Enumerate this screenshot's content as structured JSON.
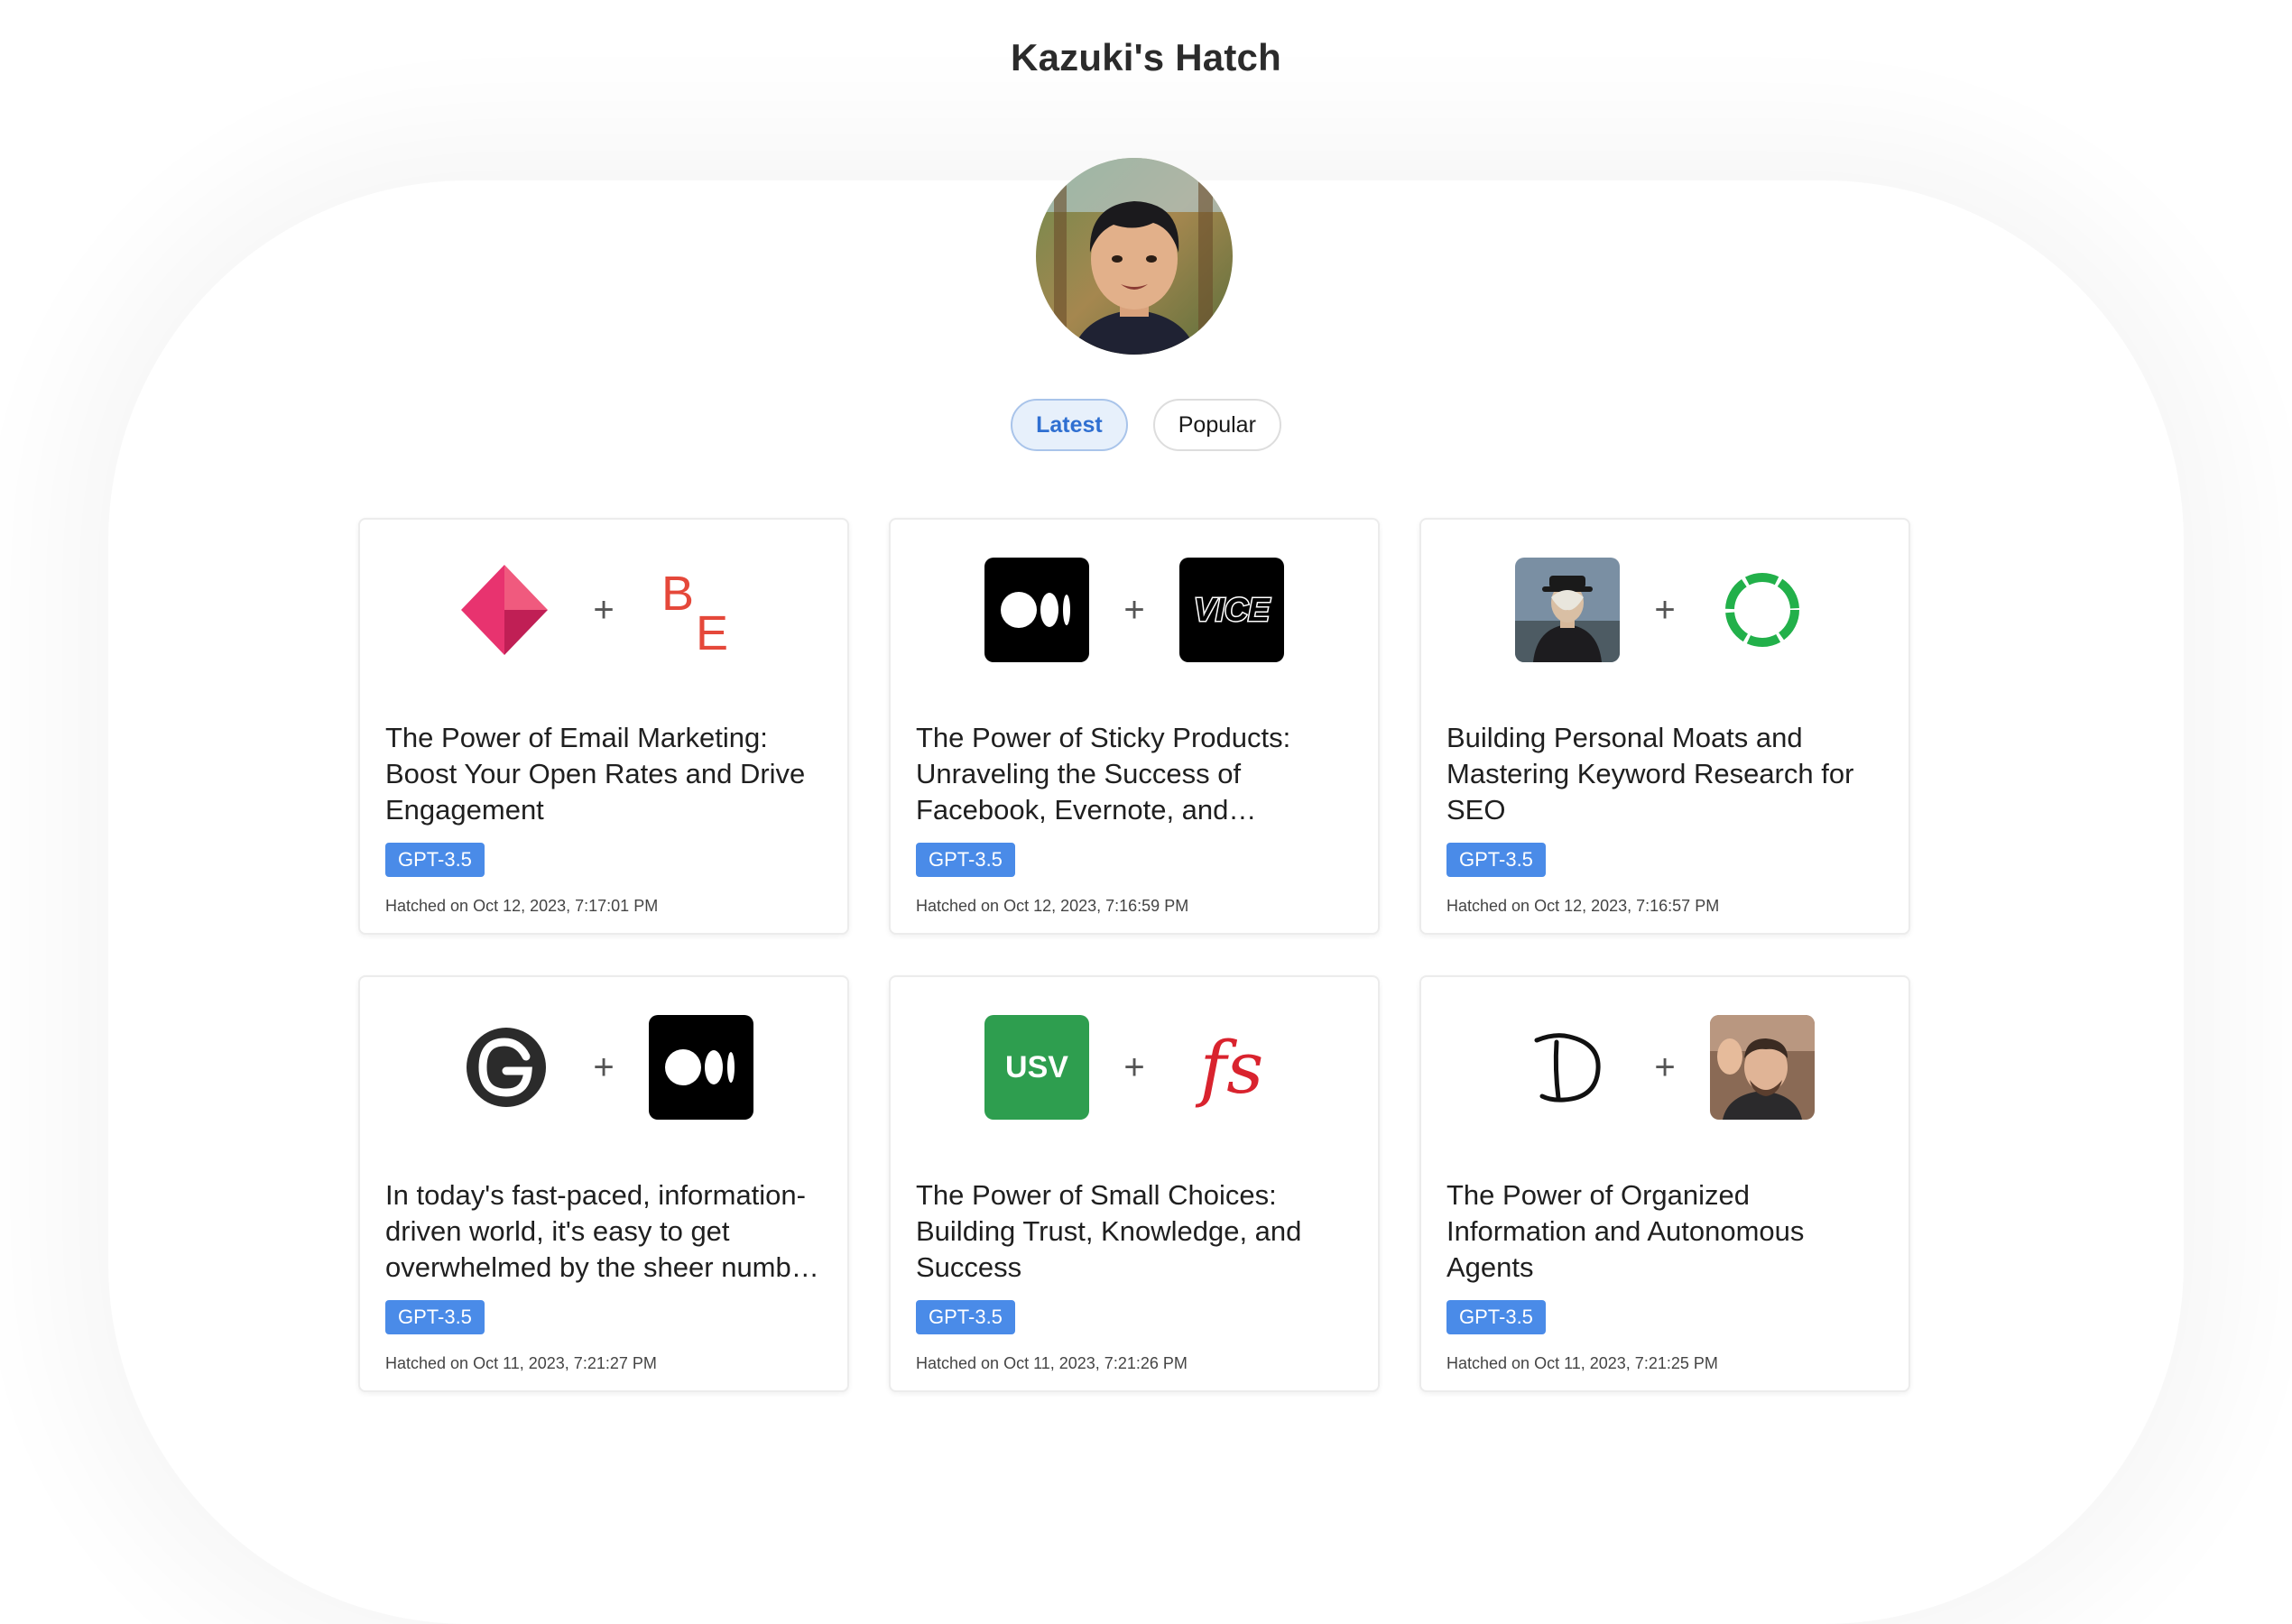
{
  "page": {
    "title": "Kazuki's Hatch"
  },
  "tabs": [
    {
      "label": "Latest",
      "active": true
    },
    {
      "label": "Popular",
      "active": false
    }
  ],
  "colors": {
    "accent_blue": "#4a8be8",
    "tab_active_text": "#2f6fd1",
    "tab_active_bg": "#e7f0fb"
  },
  "cards": [
    {
      "logo_left": "pink-diamond-logo",
      "logo_right": "be-logo",
      "logo_right_text": "BE",
      "title": "The Power of Email Marketing: Boost Your Open Rates and Drive Engagement",
      "badge": "GPT-3.5",
      "date": "Hatched on Oct 12, 2023, 7:17:01 PM"
    },
    {
      "logo_left": "medium-logo",
      "logo_right": "vice-logo",
      "logo_right_text": "VICE",
      "title": "The Power of Sticky Products: Unraveling the Success of Facebook, Evernote, and Wikipedia",
      "badge": "GPT-3.5",
      "date": "Hatched on Oct 12, 2023, 7:16:59 PM"
    },
    {
      "logo_left": "magritte-portrait",
      "logo_right": "green-ring-logo",
      "title": "Building Personal Moats and Mastering Keyword Research for SEO",
      "badge": "GPT-3.5",
      "date": "Hatched on Oct 12, 2023, 7:16:57 PM"
    },
    {
      "logo_left": "circle-g-logo",
      "logo_right": "medium-logo",
      "title": "In today's fast-paced, information-driven world, it's easy to get overwhelmed by the sheer number of information sources",
      "badge": "GPT-3.5",
      "date": "Hatched on Oct 11, 2023, 7:21:27 PM"
    },
    {
      "logo_left": "usv-logo",
      "logo_left_text": "USV",
      "logo_right": "fs-logo",
      "logo_right_text": "fs",
      "title": "The Power of Small Choices: Building Trust, Knowledge, and Success",
      "badge": "GPT-3.5",
      "date": "Hatched on Oct 11, 2023, 7:21:26 PM"
    },
    {
      "logo_left": "handwritten-d-logo",
      "logo_left_text": "D",
      "logo_right": "person-waving-photo",
      "title": "The Power of Organized Information and Autonomous Agents",
      "badge": "GPT-3.5",
      "date": "Hatched on Oct 11, 2023, 7:21:25 PM"
    }
  ]
}
